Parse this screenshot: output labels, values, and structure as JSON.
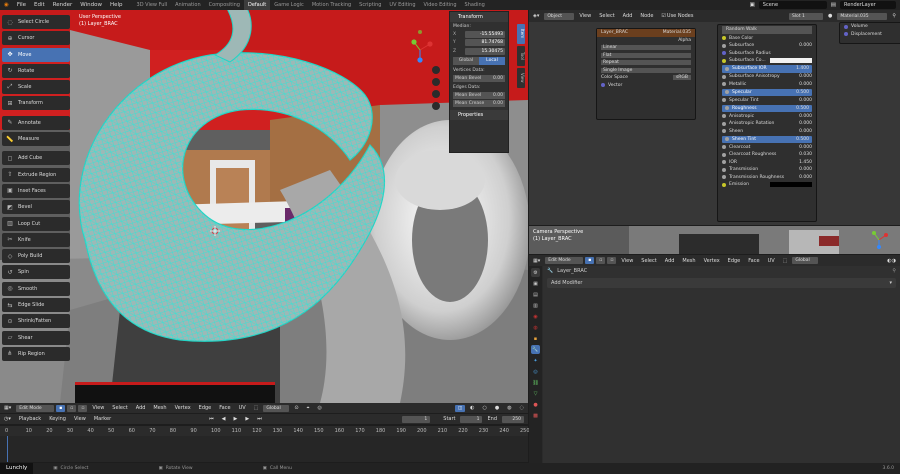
{
  "topbar": {
    "menus": [
      "File",
      "Edit",
      "Render",
      "Window",
      "Help"
    ],
    "workspaces": [
      "3D View Full",
      "Animation",
      "Compositing",
      "Default",
      "Game Logic",
      "Motion Tracking",
      "Scripting",
      "UV Editing",
      "Video Editing",
      "Shading"
    ],
    "active_workspace": "Default",
    "scene": "Scene",
    "layer": "RenderLayer"
  },
  "toolbar": {
    "tools": [
      {
        "label": "Select Circle",
        "icon": "select-circle-icon",
        "glyph": "◌",
        "active": false
      },
      {
        "label": "Cursor",
        "icon": "cursor-icon",
        "glyph": "⊕",
        "active": false
      },
      {
        "label": "Move",
        "icon": "move-icon",
        "glyph": "✥",
        "active": true
      },
      {
        "label": "Rotate",
        "icon": "rotate-icon",
        "glyph": "↻",
        "active": false
      },
      {
        "label": "Scale",
        "icon": "scale-icon",
        "glyph": "⤢",
        "active": false
      },
      {
        "label": "Transform",
        "icon": "transform-icon",
        "glyph": "⊞",
        "active": false
      },
      {
        "label": "Annotate",
        "icon": "annotate-icon",
        "glyph": "✎",
        "active": false
      },
      {
        "label": "Measure",
        "icon": "measure-icon",
        "glyph": "📏",
        "active": false
      },
      {
        "label": "Add Cube",
        "icon": "add-cube-icon",
        "glyph": "◻",
        "active": false
      },
      {
        "label": "Extrude Region",
        "icon": "extrude-icon",
        "glyph": "⇧",
        "active": false
      },
      {
        "label": "Inset Faces",
        "icon": "inset-icon",
        "glyph": "▣",
        "active": false
      },
      {
        "label": "Bevel",
        "icon": "bevel-icon",
        "glyph": "◩",
        "active": false
      },
      {
        "label": "Loop Cut",
        "icon": "loop-cut-icon",
        "glyph": "▥",
        "active": false
      },
      {
        "label": "Knife",
        "icon": "knife-icon",
        "glyph": "✂",
        "active": false
      },
      {
        "label": "Poly Build",
        "icon": "poly-build-icon",
        "glyph": "◇",
        "active": false
      },
      {
        "label": "Spin",
        "icon": "spin-icon",
        "glyph": "↺",
        "active": false
      },
      {
        "label": "Smooth",
        "icon": "smooth-icon",
        "glyph": "◎",
        "active": false
      },
      {
        "label": "Edge Slide",
        "icon": "edge-slide-icon",
        "glyph": "⇆",
        "active": false
      },
      {
        "label": "Shrink/Fatten",
        "icon": "shrink-fatten-icon",
        "glyph": "⊙",
        "active": false
      },
      {
        "label": "Shear",
        "icon": "shear-icon",
        "glyph": "▱",
        "active": false
      },
      {
        "label": "Rip Region",
        "icon": "rip-region-icon",
        "glyph": "⋔",
        "active": false
      }
    ]
  },
  "viewport": {
    "title": "User Perspective",
    "object": "(1) Layer_BRAC"
  },
  "npanel": {
    "header": "Transform",
    "median_label": "Median:",
    "x": "-15.55493",
    "y": "81.74768",
    "z": "15.30475",
    "global": "Global",
    "local": "Local",
    "vertices_label": "Vertices Data:",
    "mean_bevel_v": "Mean Bevel",
    "mean_bevel_v_val": "0.00",
    "edges_label": "Edges Data:",
    "mean_bevel_e": "Mean Bevel",
    "mean_bevel_e_val": "0.00",
    "mean_crease": "Mean Crease",
    "mean_crease_val": "0.00",
    "properties": "Properties",
    "tabs": [
      "Item",
      "Tool",
      "View"
    ]
  },
  "vp_header": {
    "mode": "Edit Mode",
    "menus": [
      "View",
      "Select",
      "Add",
      "Mesh",
      "Vertex",
      "Edge",
      "Face",
      "UV"
    ],
    "orientation": "Global"
  },
  "timeline": {
    "menus": [
      "Playback",
      "Keying",
      "View",
      "Marker"
    ],
    "current_frame": "1",
    "start_label": "Start",
    "start": "1",
    "end_label": "End",
    "end": "250",
    "ruler": [
      "0",
      "10",
      "20",
      "30",
      "40",
      "50",
      "60",
      "70",
      "80",
      "90",
      "100",
      "110",
      "120",
      "130",
      "140",
      "150",
      "160",
      "170",
      "180",
      "190",
      "200",
      "210",
      "220",
      "230",
      "240",
      "250"
    ]
  },
  "statusbar": {
    "brand": "Lunchly",
    "hints": [
      "Circle Select",
      "Rotate View",
      "Call Menu"
    ],
    "version": "3.6.0"
  },
  "shader": {
    "type": "Object",
    "menus": [
      "View",
      "Select",
      "Add",
      "Node"
    ],
    "use_nodes": "Use Nodes",
    "slot": "Slot 1",
    "material": "Material.035",
    "image_node": {
      "title": "Layer_BRAC",
      "title2": "Material.035",
      "alpha": "Alpha",
      "rows": [
        "Linear",
        "Flat",
        "Repeat",
        "Single Image"
      ],
      "colorspace_label": "Color Space",
      "colorspace": "sRGB",
      "vector": "Vector"
    },
    "bsdf_rows": [
      {
        "label": "Random Walk",
        "val": "",
        "sel": false,
        "sock": "none"
      },
      {
        "label": "Subsurface",
        "val": "0.000",
        "sel": false,
        "sock": "g"
      },
      {
        "label": "Subsurface Radius",
        "val": "",
        "sel": false,
        "sock": "p"
      },
      {
        "label": "Subsurface Co...",
        "val": "",
        "sel": false,
        "sock": "y"
      },
      {
        "label": "Subsurface IOR",
        "val": "1.400",
        "sel": true,
        "sock": "g"
      },
      {
        "label": "Subsurface Anisotropy",
        "val": "0.000",
        "sel": false,
        "sock": "g"
      },
      {
        "label": "Metallic",
        "val": "0.000",
        "sel": false,
        "sock": "g"
      },
      {
        "label": "Specular",
        "val": "0.500",
        "sel": true,
        "sock": "g"
      },
      {
        "label": "Specular Tint",
        "val": "0.000",
        "sel": false,
        "sock": "g"
      },
      {
        "label": "Roughness",
        "val": "0.500",
        "sel": true,
        "sock": "g"
      },
      {
        "label": "Anisotropic",
        "val": "0.000",
        "sel": false,
        "sock": "g"
      },
      {
        "label": "Anisotropic Rotation",
        "val": "0.000",
        "sel": false,
        "sock": "g"
      },
      {
        "label": "Sheen",
        "val": "0.000",
        "sel": false,
        "sock": "g"
      },
      {
        "label": "Sheen Tint",
        "val": "0.500",
        "sel": true,
        "sock": "g"
      },
      {
        "label": "Clearcoat",
        "val": "0.000",
        "sel": false,
        "sock": "g"
      },
      {
        "label": "Clearcoat Roughness",
        "val": "0.030",
        "sel": false,
        "sock": "g"
      },
      {
        "label": "IOR",
        "val": "1.450",
        "sel": false,
        "sock": "g"
      },
      {
        "label": "Transmission",
        "val": "0.000",
        "sel": false,
        "sock": "g"
      },
      {
        "label": "Transmission Roughness",
        "val": "0.000",
        "sel": false,
        "sock": "g"
      },
      {
        "label": "Emission",
        "val": "",
        "sel": false,
        "sock": "y"
      }
    ],
    "base_color": "Base Color",
    "output_rows": [
      "Volume",
      "Displacement"
    ]
  },
  "camview": {
    "title": "Camera Perspective",
    "object": "(1) Layer_BRAC"
  },
  "props": {
    "mode": "Edit Mode",
    "menus": [
      "View",
      "Select",
      "Add",
      "Mesh",
      "Vertex",
      "Edge",
      "Face",
      "UV"
    ],
    "orientation": "Global",
    "object_name": "Layer_BRAC",
    "add_modifier": "Add Modifier"
  }
}
